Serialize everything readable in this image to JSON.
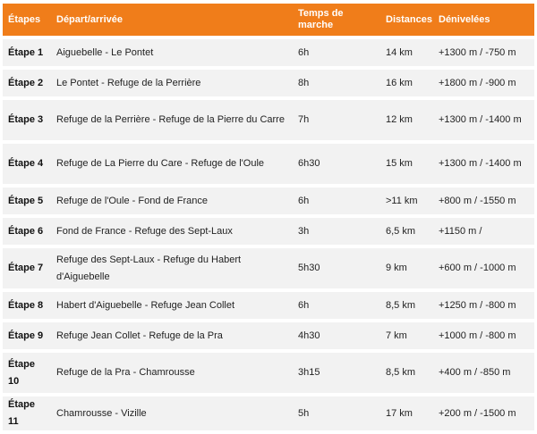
{
  "header": {
    "etapes": "Étapes",
    "depart": "Départ/arrivée",
    "temps": "Temps de marche",
    "distances": "Distances",
    "denivelees": "Dénivelées"
  },
  "rows": [
    {
      "stage": "Étape 1",
      "route": "Aiguebelle - Le Pontet",
      "time": "6h",
      "distance": "14 km",
      "elevation": "+1300 m / -750 m"
    },
    {
      "stage": "Étape 2",
      "route": "Le Pontet - Refuge de la Perrière",
      "time": "8h",
      "distance": "16 km",
      "elevation": "+1800 m / -900 m"
    },
    {
      "stage": "Étape 3",
      "route": "Refuge de la Perrière - Refuge de la Pierre du Carre",
      "time": "7h",
      "distance": "12 km",
      "elevation": "+1300 m / -1400 m"
    },
    {
      "stage": "Étape 4",
      "route": "Refuge de La Pierre du Care - Refuge de l'Oule",
      "time": "6h30",
      "distance": "15 km",
      "elevation": "+1300 m / -1400 m"
    },
    {
      "stage": "Étape 5",
      "route": "Refuge de l'Oule - Fond de France",
      "time": "6h",
      "distance": ">11 km",
      "elevation": "+800 m / -1550 m"
    },
    {
      "stage": "Étape 6",
      "route": "Fond de France - Refuge des Sept-Laux",
      "time": "3h",
      "distance": "6,5 km",
      "elevation": "+1150 m /"
    },
    {
      "stage": "Étape 7",
      "route": "Refuge des Sept-Laux - Refuge du Habert d'Aiguebelle",
      "time": "5h30",
      "distance": "9 km",
      "elevation": "+600 m / -1000 m"
    },
    {
      "stage": "Étape 8",
      "route": "Habert d'Aiguebelle - Refuge Jean Collet",
      "time": "6h",
      "distance": "8,5 km",
      "elevation": "+1250 m / -800 m"
    },
    {
      "stage": "Étape 9",
      "route": "Refuge Jean Collet - Refuge de la Pra",
      "time": "4h30",
      "distance": "7 km",
      "elevation": "+1000 m / -800 m"
    },
    {
      "stage": "Étape 10",
      "route": "Refuge de la Pra - Chamrousse",
      "time": "3h15",
      "distance": "8,5 km",
      "elevation": "+400 m / -850 m"
    },
    {
      "stage": "Étape 11",
      "route": "Chamrousse - Vizille",
      "time": "5h",
      "distance": "17 km",
      "elevation": "+200 m / -1500 m"
    }
  ]
}
